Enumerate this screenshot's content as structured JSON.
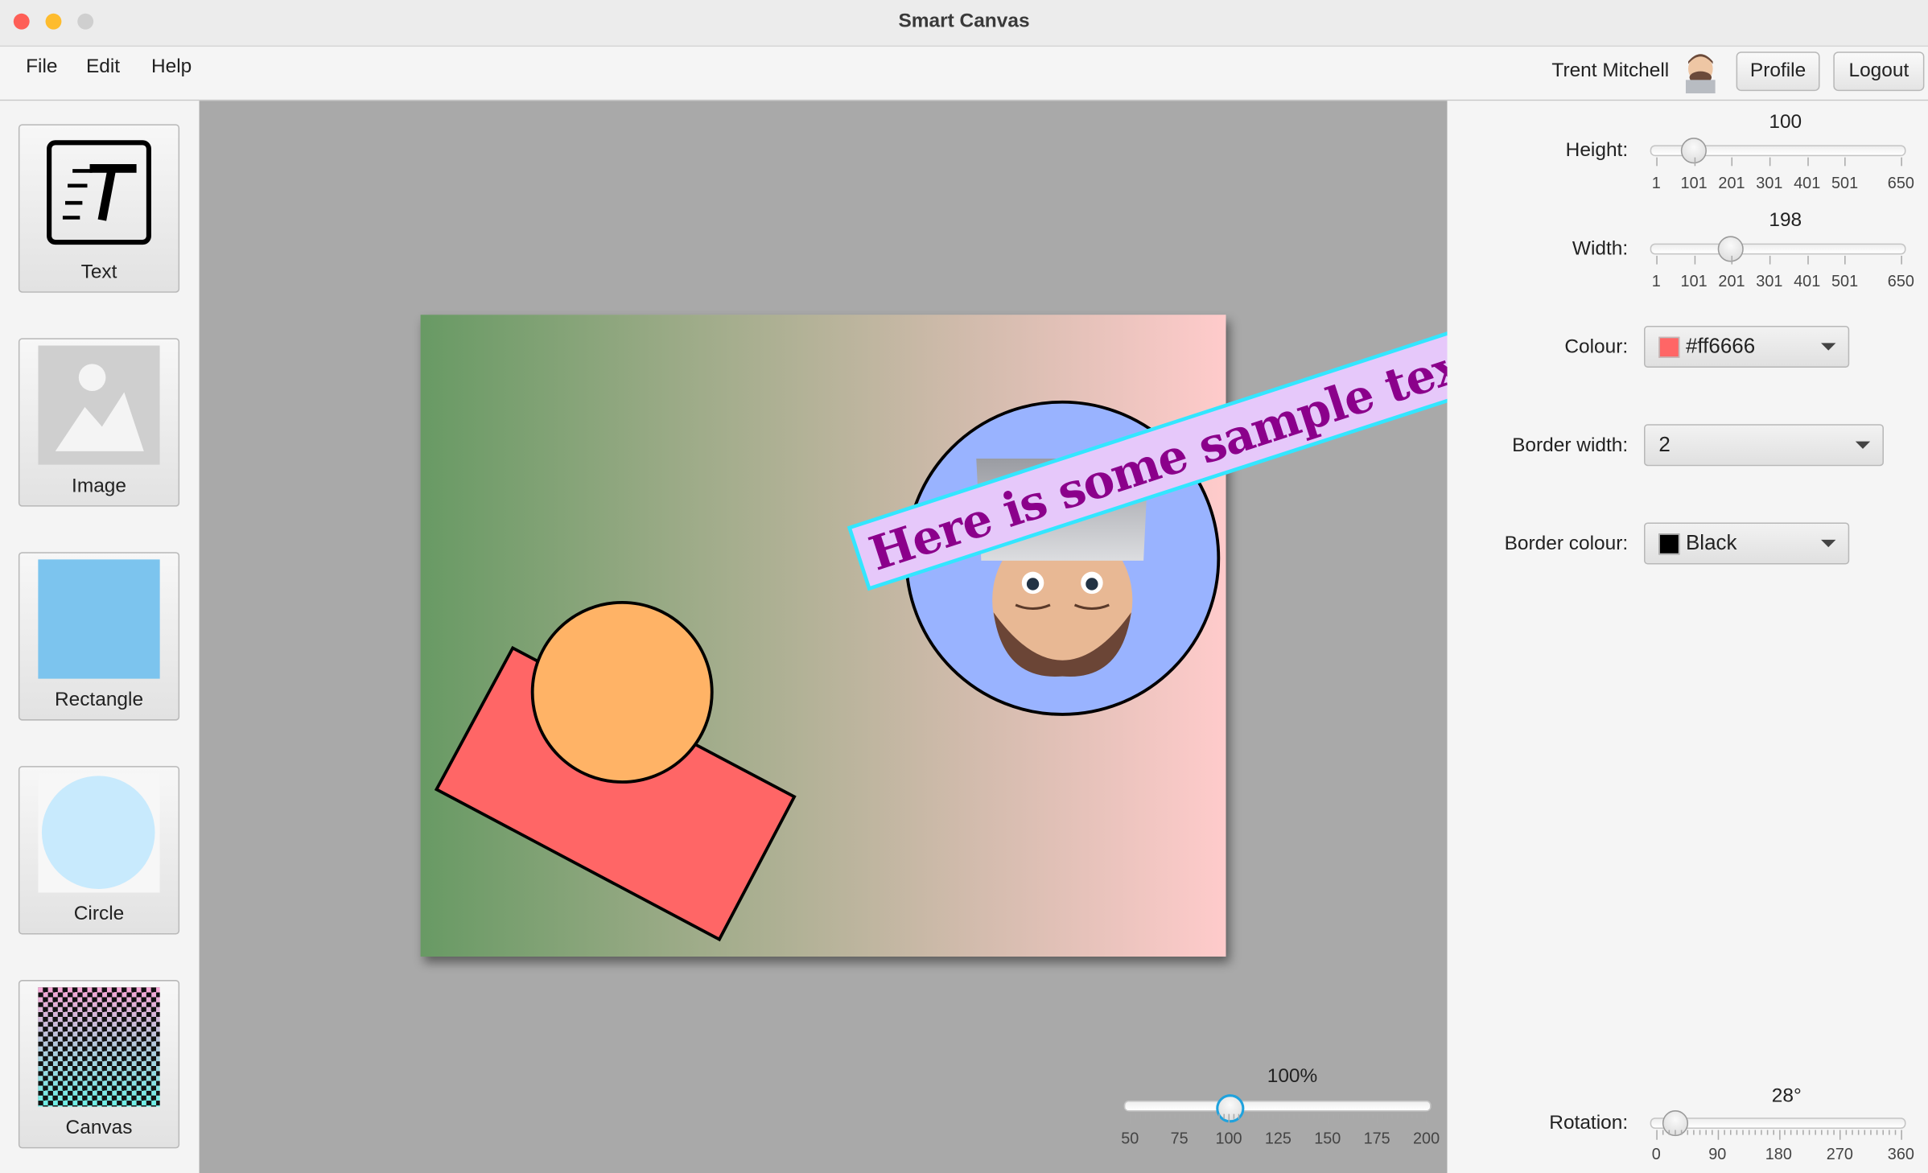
{
  "window": {
    "title": "Smart Canvas"
  },
  "menu": [
    "File",
    "Edit",
    "Help"
  ],
  "user": {
    "name": "Trent Mitchell",
    "profile_label": "Profile",
    "logout_label": "Logout"
  },
  "tools": [
    {
      "label": "Text",
      "icon": "text-tool-icon"
    },
    {
      "label": "Image",
      "icon": "image-placeholder-icon"
    },
    {
      "label": "Rectangle",
      "icon": "rectangle-icon"
    },
    {
      "label": "Circle",
      "icon": "circle-icon"
    },
    {
      "label": "Canvas",
      "icon": "checkerboard-icon"
    }
  ],
  "canvas": {
    "text_element": {
      "text": "Here is some sample text",
      "fill": "#8b008b",
      "background": "#e6c8fa",
      "selection_color": "#33e6ff"
    },
    "rectangle": {
      "fill": "#ff6666",
      "border": "#000000"
    },
    "circle": {
      "fill": "#ffb366",
      "border": "#000000"
    },
    "image_circle": {
      "fill": "#99b3ff",
      "border": "#000000"
    },
    "gradient": [
      "#689a64",
      "#ffcbcb"
    ]
  },
  "zoom": {
    "value_label": "100%",
    "value": 100,
    "min": 50,
    "max": 200,
    "ticks": [
      "50",
      "75",
      "100",
      "125",
      "150",
      "175",
      "200"
    ]
  },
  "properties": {
    "height": {
      "label": "Height:",
      "value": "100",
      "min": 1,
      "max": 650,
      "ticks": [
        "1",
        "101",
        "201",
        "301",
        "401",
        "501",
        "650"
      ]
    },
    "width": {
      "label": "Width:",
      "value": "198",
      "min": 1,
      "max": 650,
      "ticks": [
        "1",
        "101",
        "201",
        "301",
        "401",
        "501",
        "650"
      ]
    },
    "colour": {
      "label": "Colour:",
      "value": "#ff6666",
      "swatch": "#ff6666"
    },
    "border_width": {
      "label": "Border width:",
      "value": "2"
    },
    "border_colour": {
      "label": "Border colour:",
      "value": "Black",
      "swatch": "#000000"
    },
    "rotation": {
      "label": "Rotation:",
      "value_label": "28°",
      "value": 28,
      "min": 0,
      "max": 360,
      "ticks": [
        "0",
        "90",
        "180",
        "270",
        "360"
      ]
    }
  }
}
